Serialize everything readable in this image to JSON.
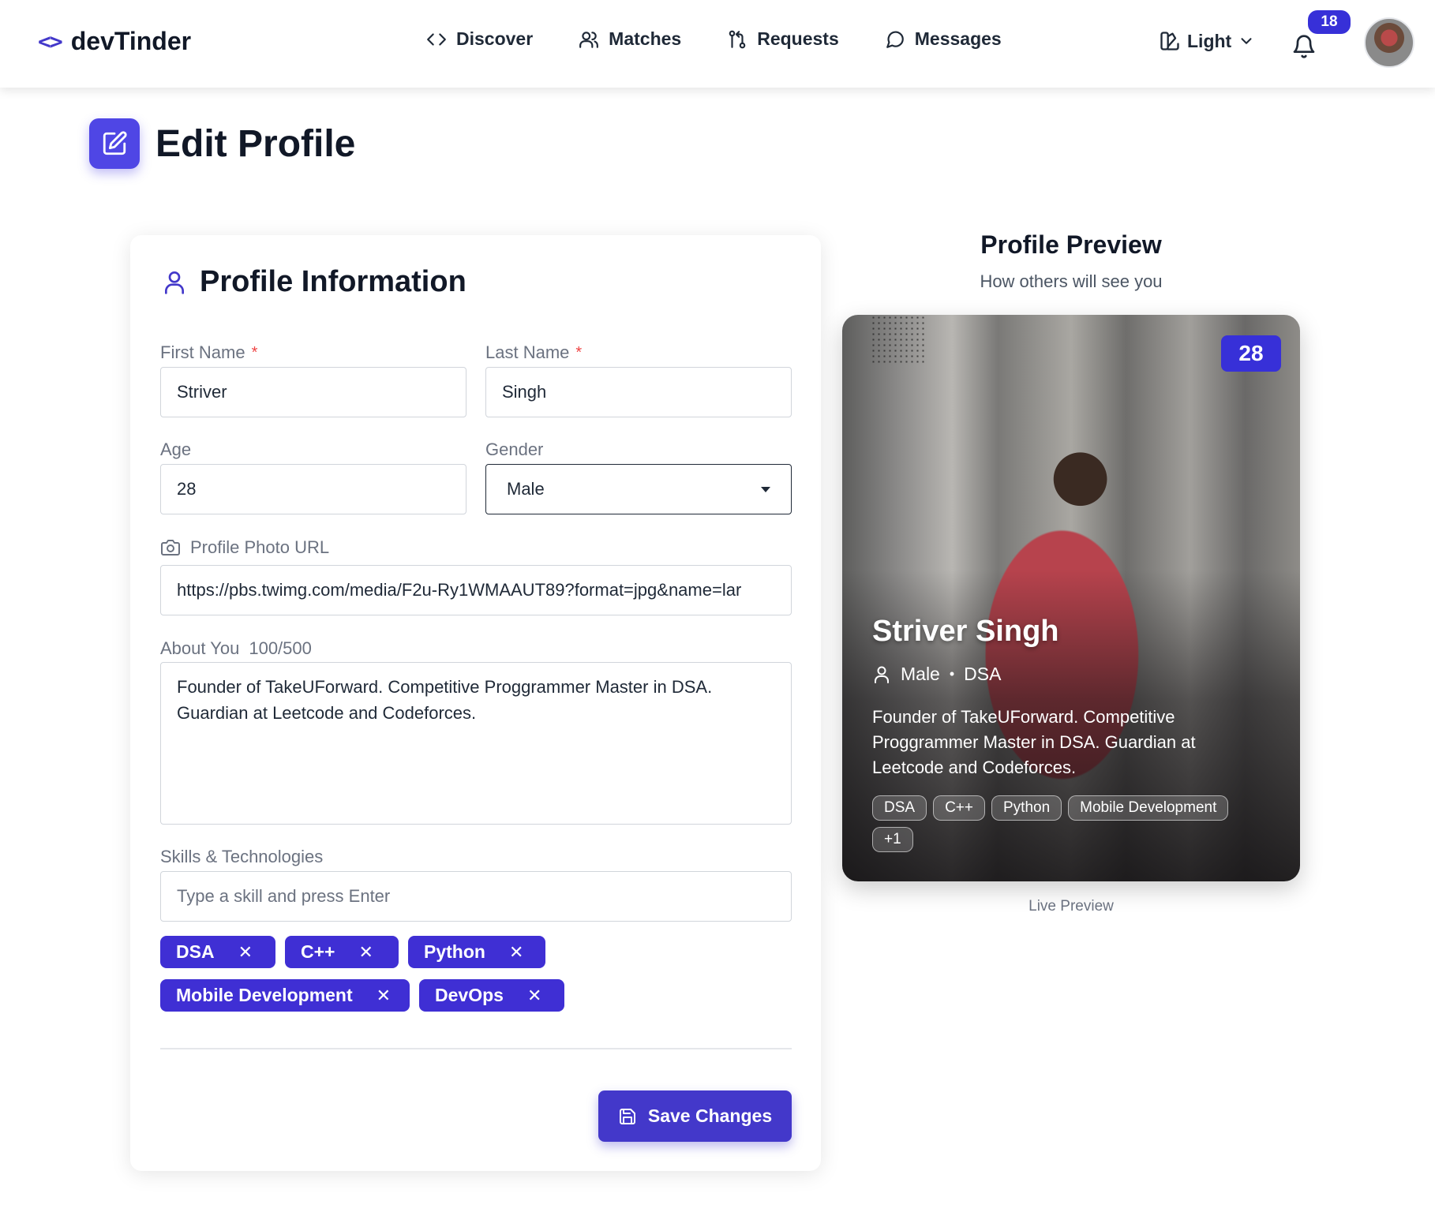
{
  "brand": {
    "name": "devTinder"
  },
  "nav": {
    "links": [
      {
        "label": "Discover",
        "icon": "code-icon"
      },
      {
        "label": "Matches",
        "icon": "users-icon"
      },
      {
        "label": "Requests",
        "icon": "git-pull-request-icon"
      },
      {
        "label": "Messages",
        "icon": "message-circle-icon"
      }
    ],
    "theme_label": "Light",
    "notification_count": "18"
  },
  "page": {
    "title": "Edit Profile"
  },
  "form": {
    "section_title": "Profile Information",
    "first_name": {
      "label": "First Name",
      "required_mark": "*",
      "value": "Striver"
    },
    "last_name": {
      "label": "Last Name",
      "required_mark": "*",
      "value": "Singh"
    },
    "age": {
      "label": "Age",
      "value": "28"
    },
    "gender": {
      "label": "Gender",
      "value": "Male"
    },
    "photo_url": {
      "label": "Profile Photo URL",
      "value": "https://pbs.twimg.com/media/F2u-Ry1WMAAUT89?format=jpg&name=lar"
    },
    "about": {
      "label": "About You",
      "count": "100/500",
      "value": "Founder of TakeUForward. Competitive Proggrammer Master in DSA. Guardian at Leetcode and Codeforces."
    },
    "skills": {
      "label": "Skills & Technologies",
      "placeholder": "Type a skill and press Enter",
      "items": [
        "DSA",
        "C++",
        "Python",
        "Mobile Development",
        "DevOps"
      ],
      "remove_glyph": "✕"
    },
    "save_label": "Save Changes"
  },
  "preview": {
    "title": "Profile Preview",
    "subtitle": "How others will see you",
    "age": "28",
    "name": "Striver Singh",
    "gender": "Male",
    "separator": "•",
    "primary_skill": "DSA",
    "about": "Founder of TakeUForward. Competitive Proggrammer Master in DSA. Guardian at Leetcode and Codeforces.",
    "tags": [
      "DSA",
      "C++",
      "Python",
      "Mobile Development",
      "+1"
    ],
    "footer": "Live Preview"
  },
  "colors": {
    "accent": "#4338ca",
    "badge": "#3730d8",
    "required": "#ef4444"
  }
}
